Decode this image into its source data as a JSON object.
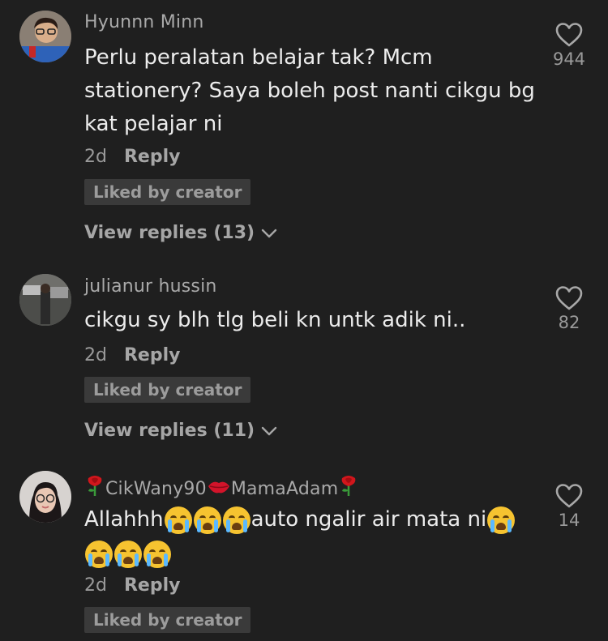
{
  "comments": [
    {
      "username": "Hyunnn Minn",
      "text": "Perlu peralatan belajar tak? Mcm stationery? Saya boleh post nanti cikgu bg kat pelajar ni",
      "time": "2d",
      "reply_label": "Reply",
      "liked_label": "Liked by creator",
      "likes": "944",
      "view_replies": "View replies (13)"
    },
    {
      "username": "julianur hussin",
      "text": "cikgu sy blh tlg beli kn untk adik ni..",
      "time": "2d",
      "reply_label": "Reply",
      "liked_label": "Liked by creator",
      "likes": "82",
      "view_replies": "View replies (11)"
    },
    {
      "username_parts": [
        "CikWany90",
        "MamaAdam"
      ],
      "text_parts": [
        "Allahhh",
        "auto ngalir air mata ni"
      ],
      "time": "2d",
      "reply_label": "Reply",
      "liked_label": "Liked by creator",
      "likes": "14"
    }
  ],
  "icons": {
    "heart": "heart-outline-icon",
    "chevron": "chevron-down-icon",
    "emoji": "loudly-crying-face-emoji",
    "rose": "rose-emoji",
    "lips": "kiss-mark-emoji"
  },
  "colors": {
    "background": "#1f1f1f",
    "text": "#ececec",
    "muted": "#9a9a9a",
    "badge": "#3a3a3a"
  }
}
